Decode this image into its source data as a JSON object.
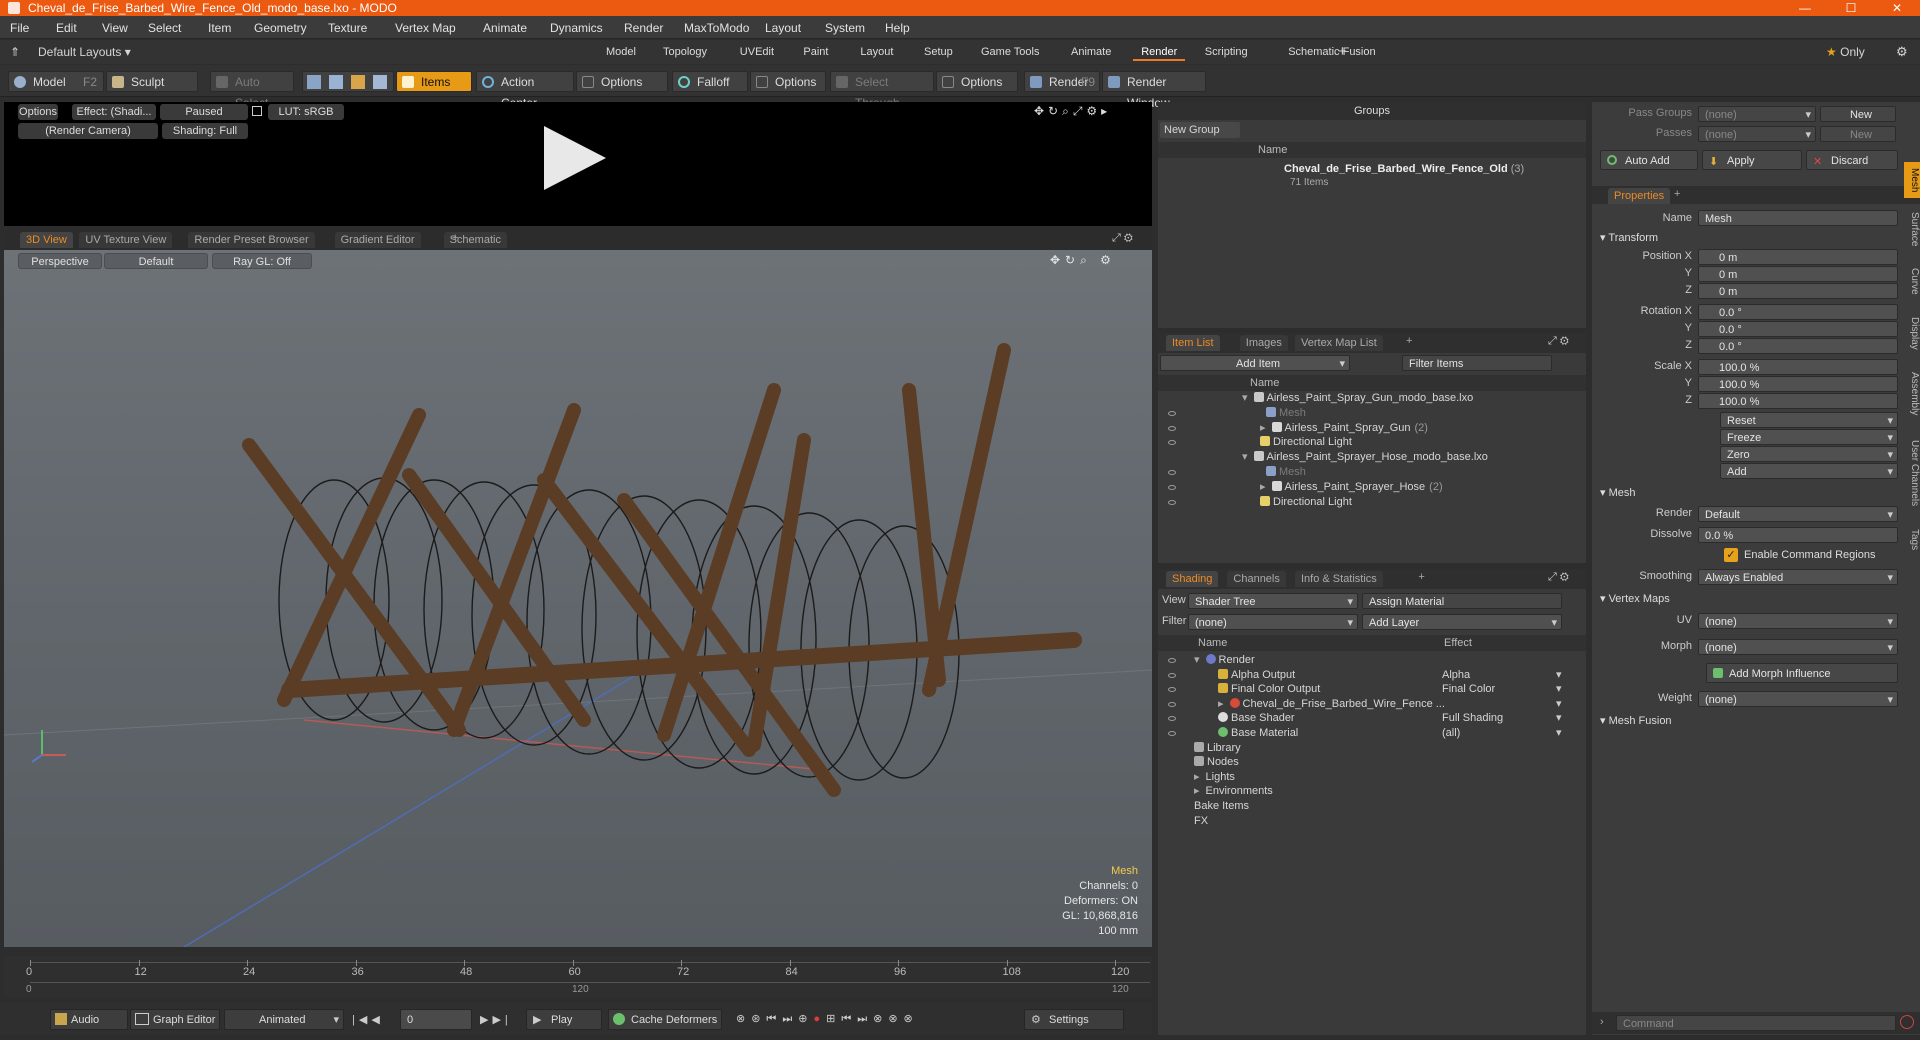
{
  "window": {
    "title": "Cheval_de_Frise_Barbed_Wire_Fence_Old_modo_base.lxo - MODO"
  },
  "menu": [
    "File",
    "Edit",
    "View",
    "Select",
    "Item",
    "Geometry",
    "Texture",
    "Vertex Map",
    "Animate",
    "Dynamics",
    "Render",
    "MaxToModo",
    "Layout",
    "System",
    "Help"
  ],
  "layoutbar": {
    "layouts_label": "Default Layouts",
    "tabs": [
      "Model",
      "Topology",
      "UVEdit",
      "Paint",
      "Layout",
      "Setup",
      "Game Tools",
      "Animate",
      "Render",
      "Scripting",
      "Schematic Fusion"
    ],
    "active_tab": "Render",
    "only_label": "Only"
  },
  "toolbar": {
    "model": "Model",
    "model_key": "F2",
    "sculpt": "Sculpt",
    "auto_select": "Auto Select",
    "items": "Items",
    "action_center": "Action Center",
    "options1": "Options",
    "falloff": "Falloff",
    "options2": "Options",
    "select_through": "Select Through",
    "options3": "Options",
    "render": "Render",
    "render_key": "F9",
    "render_window": "Render Window"
  },
  "render_preview": {
    "options": "Options",
    "effect": "Effect: (Shadi...",
    "paused": "Paused",
    "lut": "LUT: sRGB",
    "camera": "(Render Camera)",
    "shading": "Shading: Full"
  },
  "viewport_tabs": [
    "3D View",
    "UV Texture View",
    "Render Preset Browser",
    "Gradient Editor",
    "Schematic"
  ],
  "viewport": {
    "perspective": "Perspective",
    "default": "Default",
    "raygl": "Ray GL: Off",
    "stats": [
      "Mesh",
      "Channels: 0",
      "Deformers: ON",
      "GL: 10,868,816",
      "100 mm"
    ]
  },
  "timeline": {
    "ticks": [
      "0",
      "12",
      "24",
      "36",
      "48",
      "60",
      "72",
      "84",
      "96",
      "108",
      "120"
    ],
    "sub_ticks": [
      "0",
      "120",
      "120"
    ]
  },
  "bottombar": {
    "audio": "Audio",
    "graph_editor": "Graph Editor",
    "animated": "Animated",
    "frame": "0",
    "play": "Play",
    "cache_deformers": "Cache Deformers",
    "settings": "Settings"
  },
  "groups": {
    "title": "Groups",
    "new_group": "New Group",
    "name_col": "Name",
    "item_name": "Cheval_de_Frise_Barbed_Wire_Fence_Old",
    "item_count": "(3)",
    "item_sub": "71 Items"
  },
  "itemlist": {
    "tabs": [
      "Item List",
      "Images",
      "Vertex Map List"
    ],
    "add_item": "Add Item",
    "filter_items": "Filter Items",
    "name_col": "Name",
    "rows": [
      {
        "label": "Airless_Paint_Spray_Gun_modo_base.lxo",
        "indent": 0,
        "kind": "scene"
      },
      {
        "label": "Mesh",
        "indent": 2,
        "kind": "mesh-dim"
      },
      {
        "label": "Airless_Paint_Spray_Gun",
        "extra": "(2)",
        "indent": 1,
        "kind": "group"
      },
      {
        "label": "Directional Light",
        "indent": 1,
        "kind": "light"
      },
      {
        "label": "Airless_Paint_Sprayer_Hose_modo_base.lxo",
        "indent": 0,
        "kind": "scene"
      },
      {
        "label": "Mesh",
        "indent": 2,
        "kind": "mesh-dim"
      },
      {
        "label": "Airless_Paint_Sprayer_Hose",
        "extra": "(2)",
        "indent": 1,
        "kind": "group"
      },
      {
        "label": "Directional Light",
        "indent": 1,
        "kind": "light"
      }
    ]
  },
  "shading": {
    "tabs": [
      "Shading",
      "Channels",
      "Info & Statistics"
    ],
    "view_label": "View",
    "view_value": "Shader Tree",
    "assign_material": "Assign Material",
    "filter_label": "Filter",
    "filter_value": "(none)",
    "add_layer": "Add Layer",
    "name_col": "Name",
    "effect_col": "Effect",
    "rows": [
      {
        "label": "Render",
        "effect": "",
        "indent": 0
      },
      {
        "label": "Alpha Output",
        "effect": "Alpha",
        "indent": 1
      },
      {
        "label": "Final Color Output",
        "effect": "Final Color",
        "indent": 1
      },
      {
        "label": "Cheval_de_Frise_Barbed_Wire_Fence ...",
        "effect": "",
        "indent": 1
      },
      {
        "label": "Base Shader",
        "effect": "Full Shading",
        "indent": 1
      },
      {
        "label": "Base Material",
        "effect": "(all)",
        "indent": 1
      },
      {
        "label": "Library",
        "effect": "",
        "indent": 0
      },
      {
        "label": "Nodes",
        "effect": "",
        "indent": 0
      },
      {
        "label": "Lights",
        "effect": "",
        "indent": -1
      },
      {
        "label": "Environments",
        "effect": "",
        "indent": -1
      },
      {
        "label": "Bake Items",
        "effect": "",
        "indent": -1
      },
      {
        "label": "FX",
        "effect": "",
        "indent": -1
      }
    ]
  },
  "properties": {
    "pass_groups": "Pass Groups",
    "pass_groups_val": "(none)",
    "new": "New",
    "passes": "Passes",
    "passes_val": "(none)",
    "new2": "New",
    "auto_add": "Auto Add",
    "apply": "Apply",
    "discard": "Discard",
    "tab": "Properties",
    "name_label": "Name",
    "name_value": "Mesh",
    "transform": "Transform",
    "position": [
      {
        "l": "Position X",
        "v": "0 m"
      },
      {
        "l": "Y",
        "v": "0 m"
      },
      {
        "l": "Z",
        "v": "0 m"
      }
    ],
    "rotation": [
      {
        "l": "Rotation X",
        "v": "0.0 °"
      },
      {
        "l": "Y",
        "v": "0.0 °"
      },
      {
        "l": "Z",
        "v": "0.0 °"
      }
    ],
    "scale": [
      {
        "l": "Scale X",
        "v": "100.0 %"
      },
      {
        "l": "Y",
        "v": "100.0 %"
      },
      {
        "l": "Z",
        "v": "100.0 %"
      }
    ],
    "reset": "Reset",
    "freeze": "Freeze",
    "zero": "Zero",
    "add": "Add",
    "mesh": "Mesh",
    "render_label": "Render",
    "render_value": "Default",
    "dissolve_label": "Dissolve",
    "dissolve_value": "0.0 %",
    "enable_cmd": "Enable Command Regions",
    "smoothing_label": "Smoothing",
    "smoothing_value": "Always Enabled",
    "vertex_maps": "Vertex Maps",
    "uv_label": "UV",
    "uv_value": "(none)",
    "morph_label": "Morph",
    "morph_value": "(none)",
    "add_morph": "Add Morph Influence",
    "weight_label": "Weight",
    "weight_value": "(none)",
    "mesh_fusion": "Mesh Fusion",
    "side_tabs": [
      "Mesh",
      "Surface",
      "Curve",
      "Display",
      "Assembly",
      "User Channels",
      "Tags"
    ],
    "command_placeholder": "Command"
  }
}
